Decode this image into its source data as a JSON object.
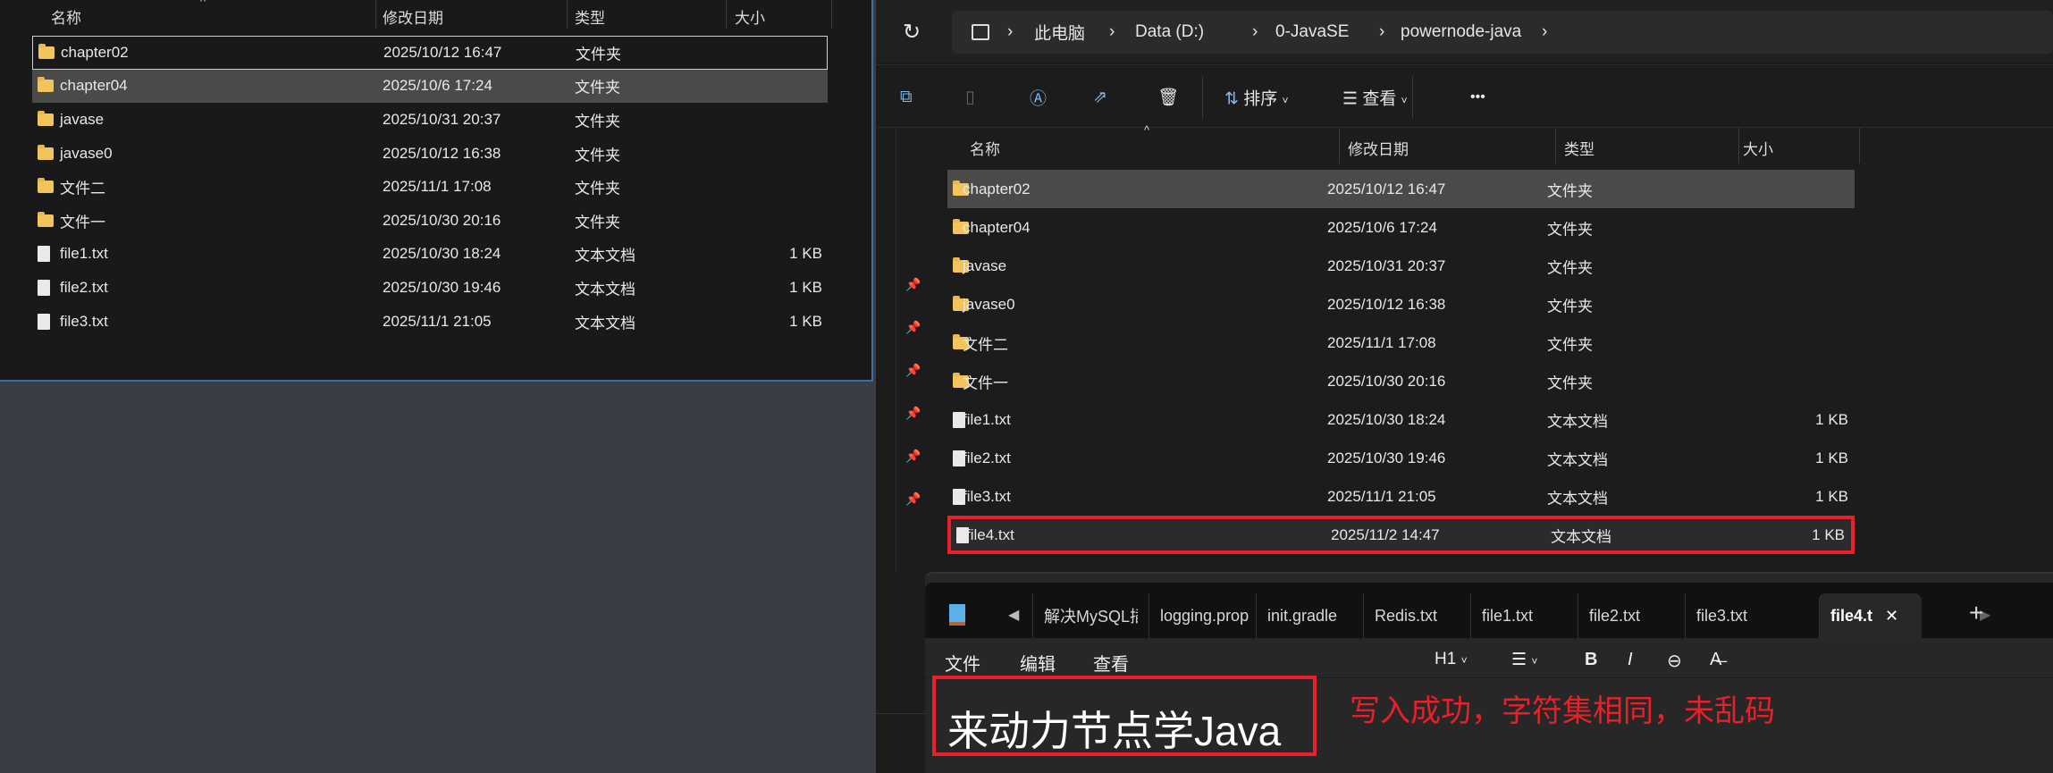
{
  "left_explorer": {
    "columns": [
      "名称",
      "修改日期",
      "类型",
      "大小"
    ],
    "rows": [
      {
        "name": "chapter02",
        "date": "2025/10/12 16:47",
        "type": "文件夹",
        "size": "",
        "icon": "folder-icon",
        "state": "focused"
      },
      {
        "name": "chapter04",
        "date": "2025/10/6 17:24",
        "type": "文件夹",
        "size": "",
        "icon": "folder-icon",
        "state": "selected"
      },
      {
        "name": "javase",
        "date": "2025/10/31 20:37",
        "type": "文件夹",
        "size": "",
        "icon": "folder-icon"
      },
      {
        "name": "javase0",
        "date": "2025/10/12 16:38",
        "type": "文件夹",
        "size": "",
        "icon": "folder-icon"
      },
      {
        "name": "文件二",
        "date": "2025/11/1 17:08",
        "type": "文件夹",
        "size": "",
        "icon": "folder-icon"
      },
      {
        "name": "文件一",
        "date": "2025/10/30 20:16",
        "type": "文件夹",
        "size": "",
        "icon": "folder-icon"
      },
      {
        "name": "file1.txt",
        "date": "2025/10/30 18:24",
        "type": "文本文档",
        "size": "1 KB",
        "icon": "text-file-icon"
      },
      {
        "name": "file2.txt",
        "date": "2025/10/30 19:46",
        "type": "文本文档",
        "size": "1 KB",
        "icon": "text-file-icon"
      },
      {
        "name": "file3.txt",
        "date": "2025/11/1 21:05",
        "type": "文本文档",
        "size": "1 KB",
        "icon": "text-file-icon"
      }
    ]
  },
  "right_explorer": {
    "breadcrumb": [
      "此电脑",
      "Data (D:)",
      "0-JavaSE",
      "powernode-java"
    ],
    "toolbar": {
      "sort": "排序",
      "view": "查看",
      "more": "•••"
    },
    "columns": [
      "名称",
      "修改日期",
      "类型",
      "大小"
    ],
    "rows": [
      {
        "name": "chapter02",
        "date": "2025/10/12 16:47",
        "type": "文件夹",
        "size": "",
        "icon": "folder-icon",
        "state": "selected"
      },
      {
        "name": "chapter04",
        "date": "2025/10/6 17:24",
        "type": "文件夹",
        "size": "",
        "icon": "folder-icon"
      },
      {
        "name": "javase",
        "date": "2025/10/31 20:37",
        "type": "文件夹",
        "size": "",
        "icon": "folder-icon"
      },
      {
        "name": "javase0",
        "date": "2025/10/12 16:38",
        "type": "文件夹",
        "size": "",
        "icon": "folder-icon"
      },
      {
        "name": "文件二",
        "date": "2025/11/1 17:08",
        "type": "文件夹",
        "size": "",
        "icon": "folder-icon"
      },
      {
        "name": "文件一",
        "date": "2025/10/30 20:16",
        "type": "文件夹",
        "size": "",
        "icon": "folder-icon"
      },
      {
        "name": "file1.txt",
        "date": "2025/10/30 18:24",
        "type": "文本文档",
        "size": "1 KB",
        "icon": "text-file-icon"
      },
      {
        "name": "file2.txt",
        "date": "2025/10/30 19:46",
        "type": "文本文档",
        "size": "1 KB",
        "icon": "text-file-icon"
      },
      {
        "name": "file3.txt",
        "date": "2025/11/1 21:05",
        "type": "文本文档",
        "size": "1 KB",
        "icon": "text-file-icon"
      },
      {
        "name": "file4.txt",
        "date": "2025/11/2 14:47",
        "type": "文本文档",
        "size": "1 KB",
        "icon": "text-file-icon",
        "state": "highlighted"
      }
    ]
  },
  "notepad": {
    "tabs": [
      "解决MySQL插",
      "logging.prop",
      "init.gradle",
      "Redis.txt",
      "file1.txt",
      "file2.txt",
      "file3.txt",
      "file4.t"
    ],
    "active_tab": "file4.t",
    "menu": [
      "文件",
      "编辑",
      "查看"
    ],
    "format": {
      "heading": "H1"
    },
    "content": "来动力节点学Java"
  },
  "annotation": "写入成功，字符集相同，未乱码",
  "colors": {
    "highlight_red": "#e8202a",
    "selection": "#4a4a4a",
    "folder": "#f2c55c",
    "accent_blue": "#3b6ea5"
  }
}
